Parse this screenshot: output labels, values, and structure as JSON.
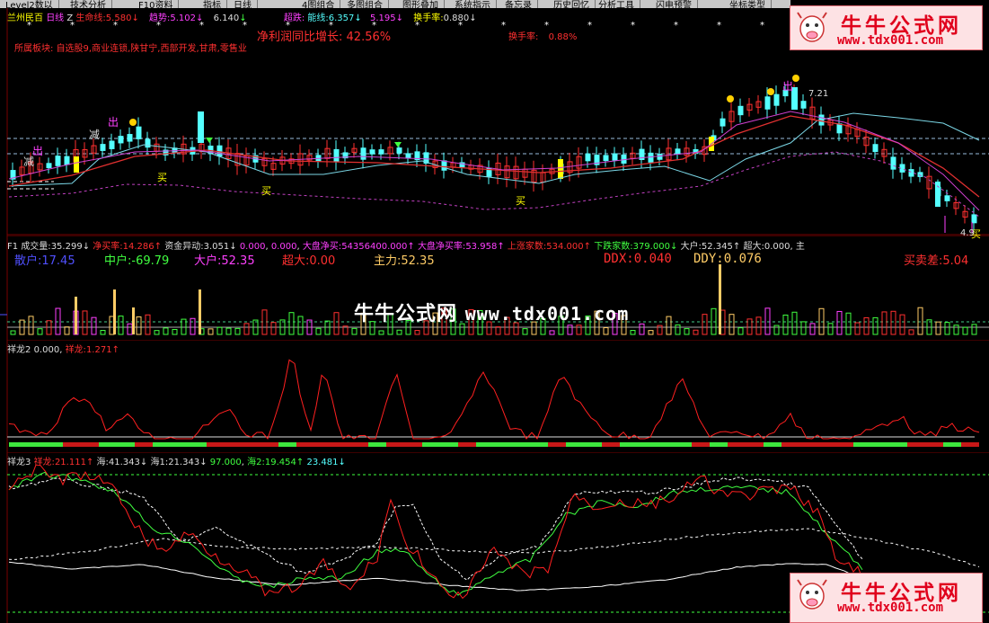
{
  "toolbar": {
    "items": [
      "Level2数以",
      "技术分析",
      "F10资料",
      "指标",
      "日线",
      "4图组合",
      "多图组合",
      "图形叠加",
      "系统指示",
      "备忘录",
      "历史回忆",
      "分析工具",
      "闪电预警",
      "坐标类型"
    ]
  },
  "header": {
    "stock_name": "兰州民百",
    "period": "日线",
    "z": "Z",
    "life_label": "生命线:",
    "life_value": "5.580",
    "life_arrow": "↓",
    "trend_label": "趋势:",
    "trend_value": "5.102",
    "trend_arrow": "↓",
    "v3": "6.140",
    "v3_arrow": "↓",
    "weak_label": "超跌:",
    "energy_label": "能线:",
    "energy_value": "6.357",
    "energy_arrow": "↓",
    "v6": "5.195",
    "v6_arrow": "↓",
    "turnover_label": "换手率:",
    "turnover_value": "0.880",
    "turnover_arrow": "↓",
    "profit_label": "净利润同比增长:",
    "profit_value": "42.56%",
    "turnover2_label": "换手率:",
    "turnover2_value": "0.88%",
    "sector_label": "所属板块:",
    "sector_value": "自选股9,商业连锁,陕甘宁,西部开发,甘肃,零售业"
  },
  "price_annotations": {
    "jian1": "减",
    "jian2": "减",
    "chu1": "出",
    "chu2": "出",
    "chu3": "出",
    "mai1": "买",
    "mai2": "买",
    "mai3": "买",
    "mai4": "买",
    "price_tag": "7.21",
    "low_tag": "4.9"
  },
  "panel1": {
    "f1": "F1",
    "vol_label": "成交量:",
    "vol_value": "35.299",
    "vol_arrow": "↓",
    "net_buy_label": "净买率:",
    "net_buy_value": "14.286",
    "net_buy_arrow": "↑",
    "fund_label": "资金异动:",
    "fund_value": "3.051",
    "fund_arrow": "↓",
    "z1": "0.000",
    "z2": "0.000",
    "market_buy_label": "大盘净买:",
    "market_buy_value": "54356400.000",
    "market_buy_arrow": "↑",
    "market_rate_label": "大盘净买率:",
    "market_rate_value": "53.958",
    "market_rate_arrow": "↑",
    "up_label": "上涨家数:",
    "up_value": "534.000",
    "up_arrow": "↑",
    "down_label": "下跌家数:",
    "down_value": "379.000",
    "down_arrow": "↓",
    "big_label": "大户:",
    "big_value": "52.345",
    "big_arrow": "↑",
    "super_label": "超大:",
    "super_value": "0.000",
    "main_label": "主",
    "retail": "散户:17.45",
    "middle": "中户:-69.79",
    "big": "大户:52.35",
    "super": "超大:0.00",
    "main": "主力:52.35",
    "ddx": "DDX:0.040",
    "ddy": "DDY:0.076",
    "trade_diff": "买卖差:5.04"
  },
  "panel2": {
    "name": "祥龙2",
    "value": "0.000,",
    "line_label": "祥龙:",
    "line_value": "1.271",
    "line_arrow": "↑"
  },
  "panel3": {
    "name": "祥龙3",
    "line_label": "祥龙:",
    "line_value": "21.111",
    "line_arrow": "↑",
    "hai_label": "海:",
    "hai_value": "41.343",
    "hai_arrow": "↓",
    "hai1_label": "海1:",
    "hai1_value": "21.343",
    "hai1_arrow": "↓",
    "v97": "97.000",
    "hai2_label": "海2:",
    "hai2_value": "19.454",
    "hai2_arrow": "↑",
    "v23": "23.481",
    "v23_arrow": "↓"
  },
  "watermark": {
    "logo_cn": "牛牛公式网",
    "logo_url": "www.tdx001.com",
    "center_cn": "牛牛公式网",
    "center_url": "www.tdx001.com"
  },
  "colors": {
    "up": "#ff3030",
    "down": "#54ffff",
    "yellow": "#ffff00",
    "magenta": "#ff40ff",
    "green": "#40ff40",
    "white": "#ffffff"
  }
}
